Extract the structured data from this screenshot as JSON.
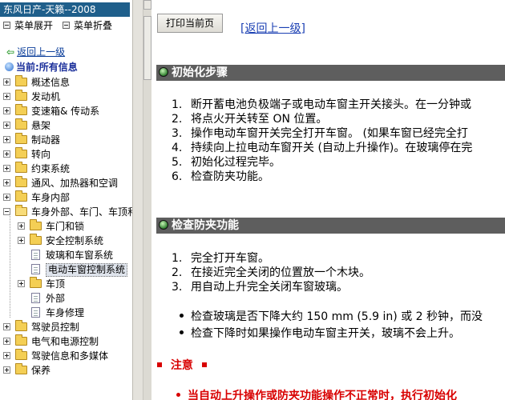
{
  "app_title": "东风日产-天籁--2008",
  "controls": {
    "expand_label": "菜单展开",
    "collapse_label": "菜单折叠"
  },
  "nav": {
    "back_label": "返回上一级",
    "current_label": "当前:所有信息"
  },
  "tree": [
    {
      "label": "概述信息",
      "level": 0,
      "expander": "plus",
      "icon": "folder"
    },
    {
      "label": "发动机",
      "level": 0,
      "expander": "plus",
      "icon": "folder"
    },
    {
      "label": "变速箱& 传动系",
      "level": 0,
      "expander": "plus",
      "icon": "folder"
    },
    {
      "label": "悬架",
      "level": 0,
      "expander": "plus",
      "icon": "folder"
    },
    {
      "label": "制动器",
      "level": 0,
      "expander": "plus",
      "icon": "folder"
    },
    {
      "label": "转向",
      "level": 0,
      "expander": "plus",
      "icon": "folder"
    },
    {
      "label": "约束系统",
      "level": 0,
      "expander": "plus",
      "icon": "folder"
    },
    {
      "label": "通风、加热器和空调",
      "level": 0,
      "expander": "plus",
      "icon": "folder"
    },
    {
      "label": "车身内部",
      "level": 0,
      "expander": "plus",
      "icon": "folder"
    },
    {
      "label": "车身外部、车门、车顶和",
      "level": 0,
      "expander": "minus",
      "icon": "folder-open"
    },
    {
      "label": "车门和锁",
      "level": 1,
      "expander": "plus",
      "icon": "folder"
    },
    {
      "label": "安全控制系统",
      "level": 1,
      "expander": "plus",
      "icon": "folder"
    },
    {
      "label": "玻璃和车窗系统",
      "level": 1,
      "expander": "none",
      "icon": "document"
    },
    {
      "label": "电动车窗控制系统",
      "level": 1,
      "expander": "none",
      "icon": "document",
      "selected": true
    },
    {
      "label": "车顶",
      "level": 1,
      "expander": "plus",
      "icon": "folder"
    },
    {
      "label": "外部",
      "level": 1,
      "expander": "none",
      "icon": "document"
    },
    {
      "label": "车身修理",
      "level": 1,
      "expander": "none",
      "icon": "document"
    },
    {
      "label": "驾驶员控制",
      "level": 0,
      "expander": "plus",
      "icon": "folder"
    },
    {
      "label": "电气和电源控制",
      "level": 0,
      "expander": "plus",
      "icon": "folder"
    },
    {
      "label": "驾驶信息和多媒体",
      "level": 0,
      "expander": "plus",
      "icon": "folder"
    },
    {
      "label": "保养",
      "level": 0,
      "expander": "plus",
      "icon": "folder"
    }
  ],
  "toolbar": {
    "print_label": "打印当前页",
    "up_label": "[返回上一级]"
  },
  "sections": {
    "init_title": "初始化步骤",
    "init_steps": [
      "断开蓄电池负极端子或电动车窗主开关接头。在一分钟或",
      "将点火开关转至  ON 位置。",
      "操作电动车窗开关完全打开车窗。  (如果车窗已经完全打",
      "持续向上拉电动车窗开关 (自动上升操作)。在玻璃停在完",
      "初始化过程完毕。",
      "检查防夹功能。"
    ],
    "check_title": "检查防夹功能",
    "check_steps": [
      "完全打开车窗。",
      "在接近完全关闭的位置放一个木块。",
      "用自动上升完全关闭车窗玻璃。"
    ],
    "check_bullets": [
      "检查玻璃是否下降大约  150 mm (5.9 in) 或  2 秒钟，而没",
      "检查下降时如果操作电动车窗主开关，玻璃不会上升。"
    ],
    "caution_title": "注意",
    "caution_text": "当自动上升操作或防夹功能操作不正常时，执行初始化"
  }
}
